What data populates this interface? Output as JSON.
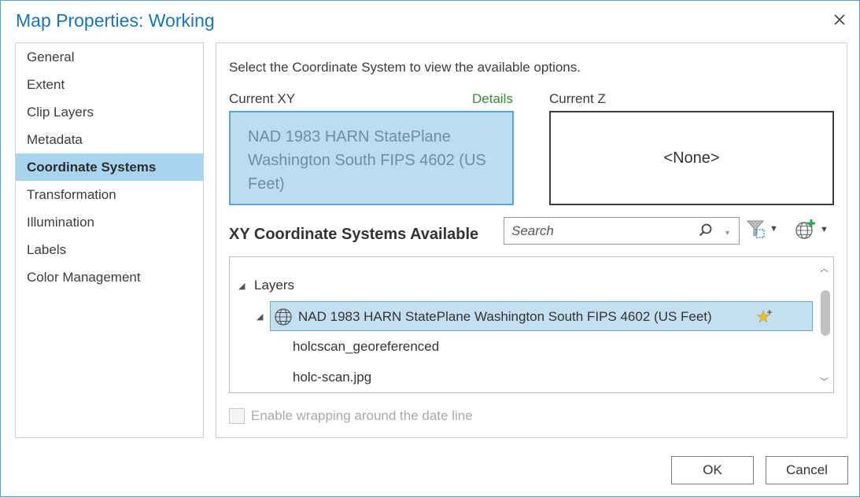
{
  "window": {
    "title": "Map Properties: Working"
  },
  "sidebar": {
    "items": [
      {
        "label": "General"
      },
      {
        "label": "Extent"
      },
      {
        "label": "Clip Layers"
      },
      {
        "label": "Metadata"
      },
      {
        "label": "Coordinate Systems",
        "active": true
      },
      {
        "label": "Transformation"
      },
      {
        "label": "Illumination"
      },
      {
        "label": "Labels"
      },
      {
        "label": "Color Management"
      }
    ]
  },
  "main": {
    "instruction": "Select the Coordinate System to view the available options.",
    "current_xy": {
      "label": "Current XY",
      "details_link": "Details",
      "value": "NAD 1983 HARN StatePlane Washington South FIPS 4602 (US Feet)"
    },
    "current_z": {
      "label": "Current Z",
      "value": "<None>"
    },
    "available": {
      "heading": "XY Coordinate Systems Available",
      "search_placeholder": "Search",
      "tree": {
        "group": "Layers",
        "selected": "NAD 1983 HARN StatePlane Washington South FIPS 4602 (US Feet)",
        "children": [
          "holcscan_georeferenced",
          "holc-scan.jpg"
        ]
      }
    },
    "wrap_checkbox": {
      "label": "Enable wrapping around the date line",
      "checked": false
    }
  },
  "buttons": {
    "ok": "OK",
    "cancel": "Cancel"
  },
  "colors": {
    "title": "#1a74b8",
    "active_nav": "#a8d4f0",
    "xy_box": "#bcdcf1",
    "details": "#3a8a3a",
    "selected_row": "#c4def2",
    "favorite_star": "#e8c22c"
  },
  "icons": {
    "close": "close-icon",
    "search": "search-icon",
    "filter": "filter-icon",
    "add_coordinate_system": "globe-add-icon",
    "coordinate_system": "globe-icon",
    "favorite": "star-add-icon"
  }
}
